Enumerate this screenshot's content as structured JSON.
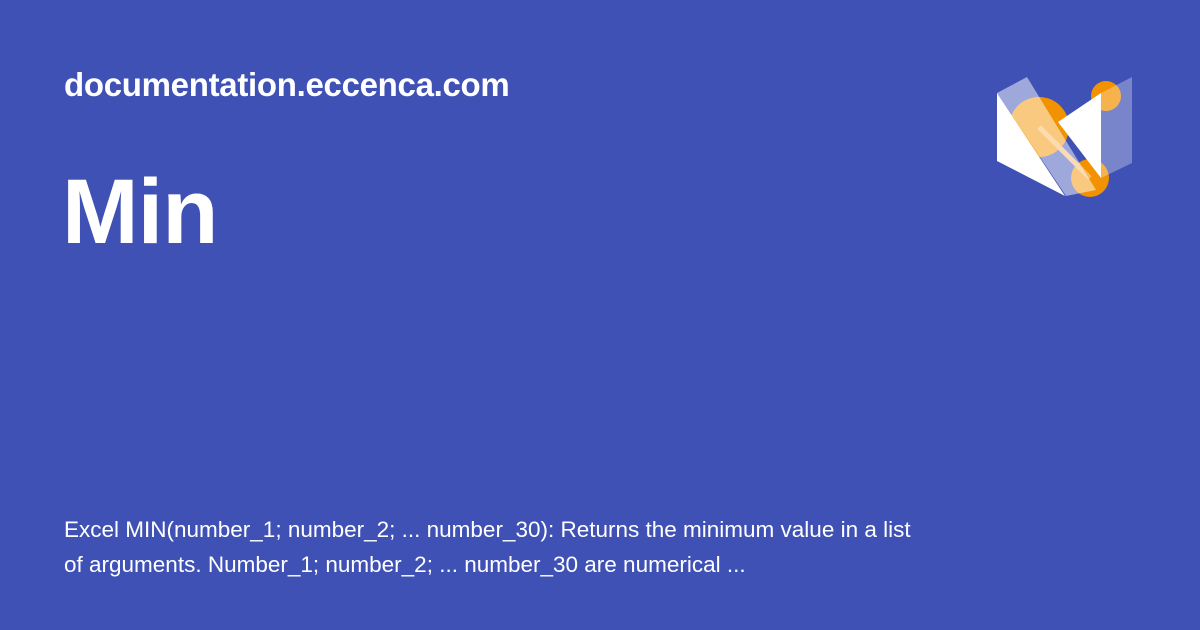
{
  "site": "documentation.eccenca.com",
  "title": "Min",
  "description": "Excel MIN(number_1; number_2; ... number_30): Returns the minimum value in a list of arguments. Number_1; number_2; ... number_30 are numerical ...",
  "colors": {
    "background": "#3f51b5",
    "accent": "#f39200"
  }
}
